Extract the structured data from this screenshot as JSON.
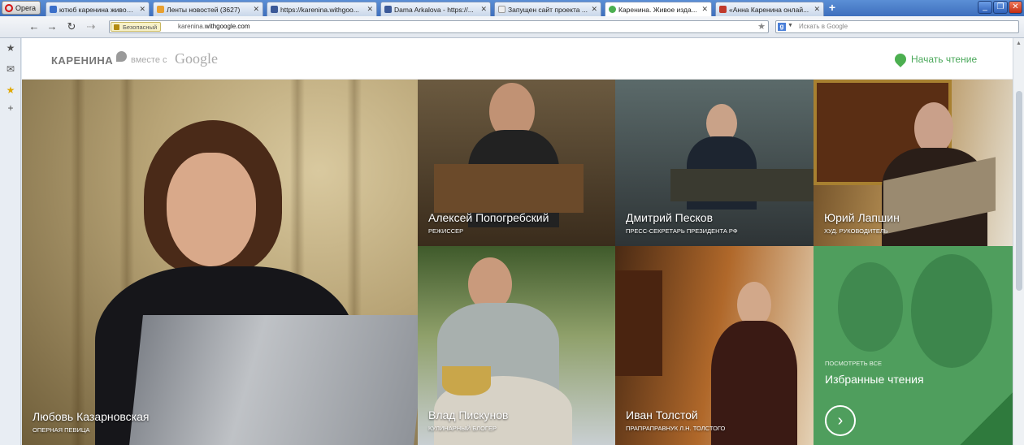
{
  "browser": {
    "menu_label": "Opera",
    "tabs": [
      {
        "label": "ютюб каренина живое ...",
        "icon_color": "#3b6fc9",
        "active": false
      },
      {
        "label": "Ленты новостей (3627)",
        "icon_color": "#e8a030",
        "active": false
      },
      {
        "label": "https://karenina.withgoo...",
        "icon_color": "#3b5998",
        "active": false
      },
      {
        "label": "Dama Arkalova - https://...",
        "icon_color": "#3b5998",
        "active": false
      },
      {
        "label": "Запущен сайт проекта ...",
        "icon_color": "#cccccc",
        "active": false
      },
      {
        "label": "Каренина. Живое изда...",
        "icon_color": "#4caf50",
        "active": true
      },
      {
        "label": "«Анна Каренина онлай...",
        "icon_color": "#c0392b",
        "active": false
      }
    ],
    "secure_label": "Безопасный",
    "url_prefix": "karenina.",
    "url_domain": "withgoogle.com",
    "search_placeholder": "Искать в Google",
    "search_engine_letter": "g"
  },
  "header": {
    "logo_text": "КАРЕНИНА",
    "with_text": "вместе с",
    "google_text": "Google",
    "start_reading": "Начать чтение"
  },
  "tiles": [
    {
      "name": "Любовь Казарновская",
      "role": "ОПЕРНАЯ ПЕВИЦА"
    },
    {
      "name": "Алексей Попогребский",
      "role": "РЕЖИССЕР"
    },
    {
      "name": "Дмитрий Песков",
      "role": "ПРЕСС-СЕКРЕТАРЬ ПРЕЗИДЕНТА РФ"
    },
    {
      "name": "Юрий Лапшин",
      "role": "ХУД. РУКОВОДИТЕЛЬ"
    },
    {
      "name": "Влад Пискунов",
      "role": "КУЛИНАРНЫЙ БЛОГЕР"
    },
    {
      "name": "Иван Толстой",
      "role": "ПРАПРАПРАВНУК Л.Н. ТОЛСТОГО"
    }
  ],
  "featured": {
    "small_label": "ПОСМОТРЕТЬ ВСЕ",
    "title": "Избранные чтения"
  }
}
